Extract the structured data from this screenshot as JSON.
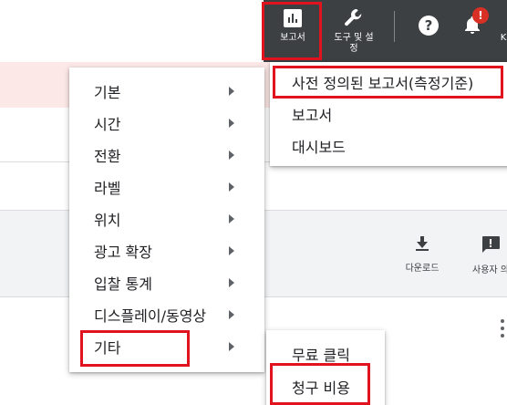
{
  "topbar": {
    "reports_label": "보고서",
    "tools_label": "도구 및 설정",
    "help_icon_glyph": "?",
    "notification_badge": "!",
    "more_label": "K"
  },
  "toolbar": {
    "download_label": "다운로드",
    "user_label": "사용자 의"
  },
  "category_menu": {
    "items": [
      {
        "label": "기본"
      },
      {
        "label": "시간"
      },
      {
        "label": "전환"
      },
      {
        "label": "라벨"
      },
      {
        "label": "위치"
      },
      {
        "label": "광고 확장"
      },
      {
        "label": "입찰 통계"
      },
      {
        "label": "디스플레이/동영상"
      },
      {
        "label": "기타"
      }
    ]
  },
  "reports_menu": {
    "items": [
      {
        "label": "사전 정의된 보고서(측정기준)"
      },
      {
        "label": "보고서"
      },
      {
        "label": "대시보드"
      }
    ]
  },
  "other_menu": {
    "items": [
      {
        "label": "무료 클릭"
      },
      {
        "label": "청구 비용"
      }
    ]
  },
  "colors": {
    "highlight": "#e0131f",
    "topbar": "#3c4043",
    "alert_badge": "#d93025"
  }
}
